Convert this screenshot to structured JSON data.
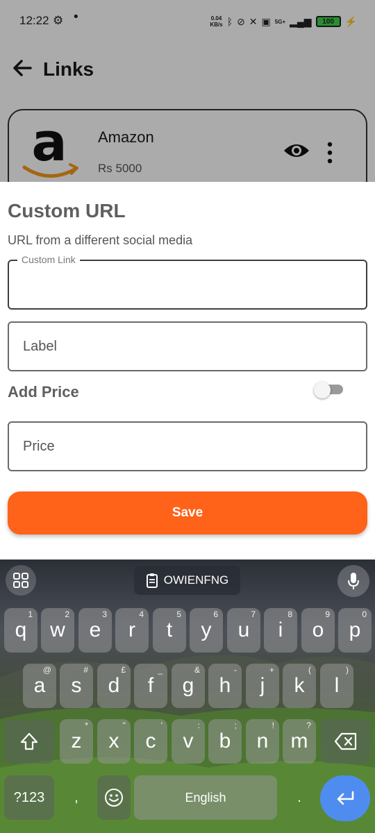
{
  "status_bar": {
    "time": "12:22",
    "net_speed_value": "0.04",
    "net_speed_unit": "KB/s",
    "signal_label": "5G+",
    "battery": "100"
  },
  "app_bar": {
    "title": "Links"
  },
  "link_card": {
    "name": "Amazon",
    "price": "Rs 5000"
  },
  "sheet": {
    "title": "Custom URL",
    "subtitle": "URL from a different social media",
    "custom_link": {
      "legend": "Custom Link",
      "value": ""
    },
    "label_field": {
      "placeholder": "Label",
      "value": ""
    },
    "add_price_label": "Add Price",
    "add_price_enabled": false,
    "price_field": {
      "placeholder": "Price",
      "value": ""
    },
    "save_label": "Save"
  },
  "keyboard": {
    "clipboard_text": "OWIENFNG",
    "row1": [
      {
        "key": "q",
        "hint": "1"
      },
      {
        "key": "w",
        "hint": "2"
      },
      {
        "key": "e",
        "hint": "3"
      },
      {
        "key": "r",
        "hint": "4"
      },
      {
        "key": "t",
        "hint": "5"
      },
      {
        "key": "y",
        "hint": "6"
      },
      {
        "key": "u",
        "hint": "7"
      },
      {
        "key": "i",
        "hint": "8"
      },
      {
        "key": "o",
        "hint": "9"
      },
      {
        "key": "p",
        "hint": "0"
      }
    ],
    "row2": [
      {
        "key": "a",
        "hint": "@"
      },
      {
        "key": "s",
        "hint": "#"
      },
      {
        "key": "d",
        "hint": "£"
      },
      {
        "key": "f",
        "hint": "_"
      },
      {
        "key": "g",
        "hint": "&"
      },
      {
        "key": "h",
        "hint": "-"
      },
      {
        "key": "j",
        "hint": "+"
      },
      {
        "key": "k",
        "hint": "("
      },
      {
        "key": "l",
        "hint": ")"
      }
    ],
    "row3": [
      {
        "key": "z",
        "hint": "*"
      },
      {
        "key": "x",
        "hint": "\""
      },
      {
        "key": "c",
        "hint": "'"
      },
      {
        "key": "v",
        "hint": ":"
      },
      {
        "key": "b",
        "hint": ";"
      },
      {
        "key": "n",
        "hint": "!"
      },
      {
        "key": "m",
        "hint": "?"
      }
    ],
    "symbols_label": "?123",
    "comma": ",",
    "space_label": "English",
    "period": "."
  }
}
